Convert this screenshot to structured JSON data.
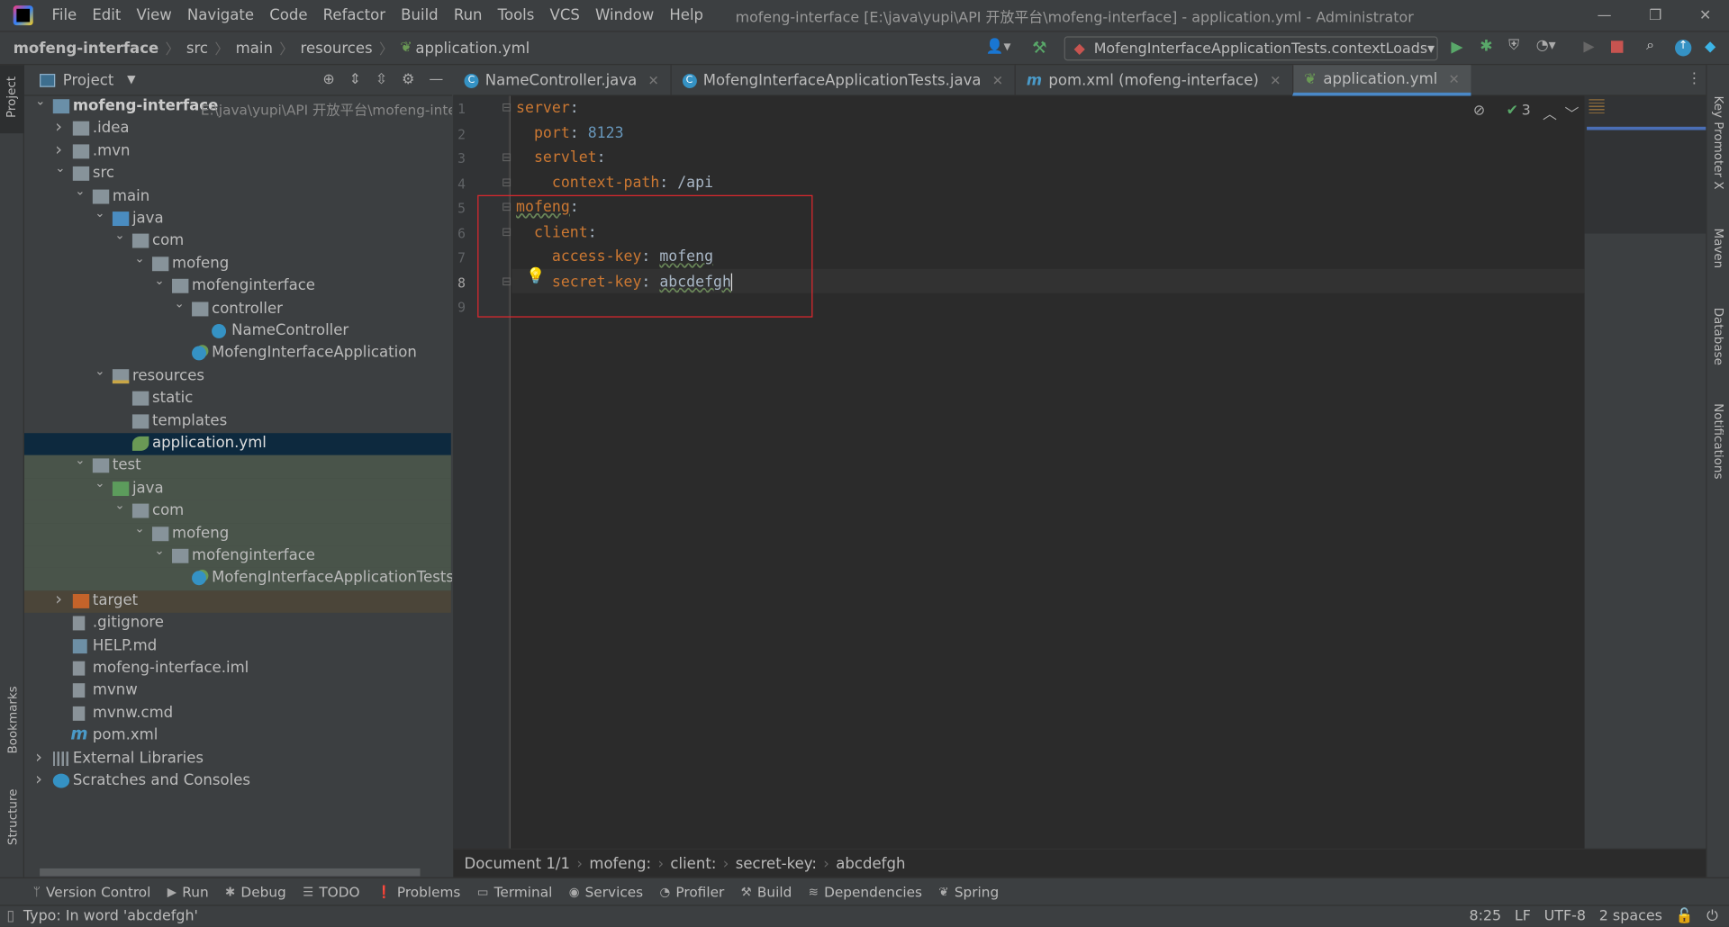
{
  "menu": [
    "File",
    "Edit",
    "View",
    "Navigate",
    "Code",
    "Refactor",
    "Build",
    "Run",
    "Tools",
    "VCS",
    "Window",
    "Help"
  ],
  "window_title": "mofeng-interface [E:\\java\\yupi\\API 开放平台\\mofeng-interface] - application.yml - Administrator",
  "breadcrumbs": [
    "mofeng-interface",
    "src",
    "main",
    "resources",
    "application.yml"
  ],
  "run_config": "MofengInterfaceApplicationTests.contextLoads",
  "project_panel": {
    "title": "Project"
  },
  "tree": [
    {
      "label": "mofeng-interface",
      "level": 0,
      "arrow": "open",
      "icon": "module",
      "path": "E:\\java\\yupi\\API 开放平台\\mofeng-inter"
    },
    {
      "label": ".idea",
      "level": 1,
      "arrow": "closed",
      "icon": "folder"
    },
    {
      "label": ".mvn",
      "level": 1,
      "arrow": "closed",
      "icon": "folder"
    },
    {
      "label": "src",
      "level": 1,
      "arrow": "open",
      "icon": "folder"
    },
    {
      "label": "main",
      "level": 2,
      "arrow": "open",
      "icon": "folder"
    },
    {
      "label": "java",
      "level": 3,
      "arrow": "open",
      "icon": "source-folder"
    },
    {
      "label": "com",
      "level": 4,
      "arrow": "open",
      "icon": "package"
    },
    {
      "label": "mofeng",
      "level": 5,
      "arrow": "open",
      "icon": "package"
    },
    {
      "label": "mofenginterface",
      "level": 6,
      "arrow": "open",
      "icon": "package"
    },
    {
      "label": "controller",
      "level": 7,
      "arrow": "open",
      "icon": "package"
    },
    {
      "label": "NameController",
      "level": 8,
      "arrow": "",
      "icon": "class"
    },
    {
      "label": "MofengInterfaceApplication",
      "level": 7,
      "arrow": "",
      "icon": "spring-class"
    },
    {
      "label": "resources",
      "level": 3,
      "arrow": "open",
      "icon": "resources-folder"
    },
    {
      "label": "static",
      "level": 4,
      "arrow": "",
      "icon": "folder"
    },
    {
      "label": "templates",
      "level": 4,
      "arrow": "",
      "icon": "folder"
    },
    {
      "label": "application.yml",
      "level": 4,
      "arrow": "",
      "icon": "yaml",
      "state": "selected"
    },
    {
      "label": "test",
      "level": 2,
      "arrow": "open",
      "icon": "folder",
      "state": "test"
    },
    {
      "label": "java",
      "level": 3,
      "arrow": "open",
      "icon": "test-folder",
      "state": "test"
    },
    {
      "label": "com",
      "level": 4,
      "arrow": "open",
      "icon": "package",
      "state": "test"
    },
    {
      "label": "mofeng",
      "level": 5,
      "arrow": "open",
      "icon": "package",
      "state": "test"
    },
    {
      "label": "mofenginterface",
      "level": 6,
      "arrow": "open",
      "icon": "package",
      "state": "test"
    },
    {
      "label": "MofengInterfaceApplicationTests",
      "level": 7,
      "arrow": "",
      "icon": "spring-class",
      "state": "test"
    },
    {
      "label": "target",
      "level": 1,
      "arrow": "closed",
      "icon": "excluded-folder",
      "state": "excluded"
    },
    {
      "label": ".gitignore",
      "level": 1,
      "arrow": "",
      "icon": "file"
    },
    {
      "label": "HELP.md",
      "level": 1,
      "arrow": "",
      "icon": "markdown"
    },
    {
      "label": "mofeng-interface.iml",
      "level": 1,
      "arrow": "",
      "icon": "file"
    },
    {
      "label": "mvnw",
      "level": 1,
      "arrow": "",
      "icon": "script"
    },
    {
      "label": "mvnw.cmd",
      "level": 1,
      "arrow": "",
      "icon": "file"
    },
    {
      "label": "pom.xml",
      "level": 1,
      "arrow": "",
      "icon": "maven"
    },
    {
      "label": "External Libraries",
      "level": 0,
      "arrow": "closed",
      "icon": "library"
    },
    {
      "label": "Scratches and Consoles",
      "level": 0,
      "arrow": "closed",
      "icon": "scratch"
    }
  ],
  "tabs": [
    {
      "label": "NameController.java",
      "icon": "class"
    },
    {
      "label": "MofengInterfaceApplicationTests.java",
      "icon": "spring-class"
    },
    {
      "label": "pom.xml (mofeng-interface)",
      "icon": "maven"
    },
    {
      "label": "application.yml",
      "icon": "yaml",
      "active": true
    }
  ],
  "editor": {
    "inspection_count": "3",
    "lines": [
      [
        {
          "t": "server",
          "c": "k"
        },
        {
          "t": ":",
          "c": "p"
        }
      ],
      [
        {
          "t": "  port",
          "c": "k"
        },
        {
          "t": ": ",
          "c": "p"
        },
        {
          "t": "8123",
          "c": "n"
        }
      ],
      [
        {
          "t": "  servlet",
          "c": "k"
        },
        {
          "t": ":",
          "c": "p"
        }
      ],
      [
        {
          "t": "    context-path",
          "c": "k"
        },
        {
          "t": ": /api",
          "c": "p"
        }
      ],
      [
        {
          "t": "mofeng",
          "c": "k wavy"
        },
        {
          "t": ":",
          "c": "p"
        }
      ],
      [
        {
          "t": "  client",
          "c": "k"
        },
        {
          "t": ":",
          "c": "p"
        }
      ],
      [
        {
          "t": "    access-key",
          "c": "k"
        },
        {
          "t": ": ",
          "c": "p"
        },
        {
          "t": "mofeng",
          "c": "p wavy"
        }
      ],
      [
        {
          "t": "    secret-key",
          "c": "k"
        },
        {
          "t": ": ",
          "c": "p"
        },
        {
          "t": "abcdefgh",
          "c": "p wavy"
        }
      ],
      []
    ]
  },
  "editor_breadcrumbs": [
    "Document 1/1",
    "mofeng:",
    "client:",
    "secret-key:",
    "abcdefgh"
  ],
  "tool_windows": [
    "Version Control",
    "Run",
    "Debug",
    "TODO",
    "Problems",
    "Terminal",
    "Services",
    "Profiler",
    "Build",
    "Dependencies",
    "Spring"
  ],
  "left_strip": [
    "Project",
    "Bookmarks",
    "Structure"
  ],
  "right_strip": [
    "Key Promoter X",
    "Maven",
    "Database",
    "Notifications"
  ],
  "status": {
    "message": "Typo: In word 'abcdefgh'",
    "position": "8:25",
    "line_sep": "LF",
    "encoding": "UTF-8",
    "indent": "2 spaces"
  },
  "colors": {
    "accent": "#4a88c7",
    "highlight_box": "#e0282e",
    "keyword": "#cc7832",
    "number": "#6897bb"
  }
}
